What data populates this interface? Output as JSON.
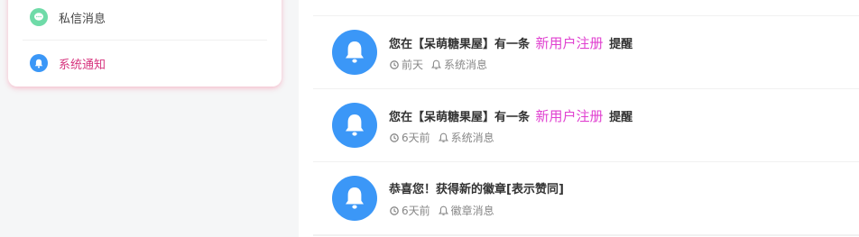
{
  "sidebar": {
    "items": [
      {
        "label": "私信消息",
        "icon": "chat-bubble-icon",
        "color": "#6fdba8"
      },
      {
        "label": "系统通知",
        "icon": "bell-icon",
        "color": "#3b97f7",
        "active": true
      }
    ]
  },
  "notifications": [
    {
      "pre": "您在【呆萌糖果屋】有一条",
      "highlight": "新用户注册",
      "post": "提醒",
      "time": "前天",
      "tag": "系统消息"
    },
    {
      "pre": "您在【呆萌糖果屋】有一条",
      "highlight": "新用户注册",
      "post": "提醒",
      "time": "6天前",
      "tag": "系统消息"
    },
    {
      "pre": "恭喜您！获得新的徽章[表示赞同]",
      "highlight": "",
      "post": "",
      "time": "6天前",
      "tag": "徽章消息"
    }
  ],
  "colors": {
    "accent_pink": "#d6337d",
    "highlight_magenta": "#e041d0",
    "avatar_blue": "#3b97f7",
    "chat_green": "#6fdba8"
  }
}
